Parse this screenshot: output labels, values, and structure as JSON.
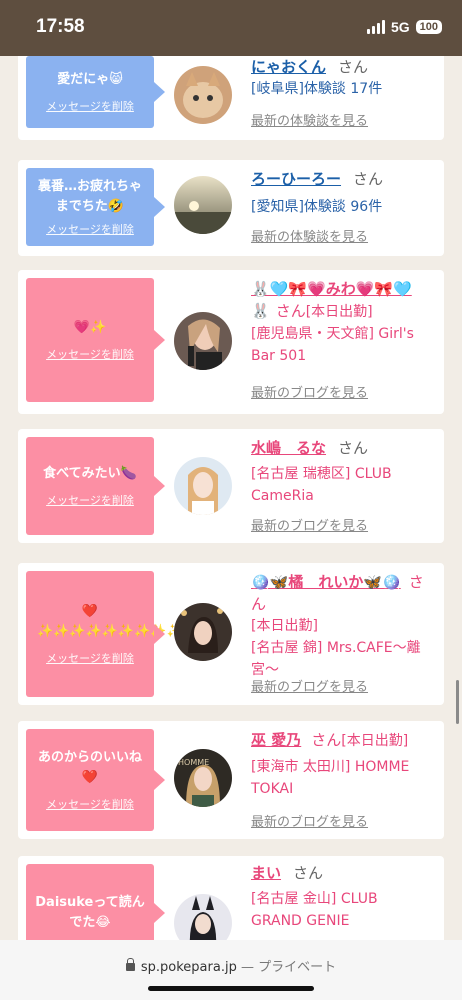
{
  "status": {
    "time": "17:58",
    "network": "5G",
    "battery": "100"
  },
  "cards": [
    {
      "bubble": {
        "text": "愛だにゃ😸",
        "delete": "メッセージを削除",
        "color": "#8bb2f0"
      },
      "name": "にゃおくん",
      "suffix": "さん",
      "badge": "",
      "lines": [
        "[岐阜県]体験談 17件"
      ],
      "link": "最新の体験談を見る",
      "avatar": "cat-photo"
    },
    {
      "bubble": {
        "text": "裏番…お疲れちゃまでちた🤣",
        "delete": "メッセージを削除",
        "color": "#8bb2f0"
      },
      "name": "ろーひーろー",
      "suffix": "さん",
      "badge": "",
      "lines": [
        "[愛知県]体験談 96件"
      ],
      "link": "最新の体験談を見る",
      "avatar": "sunset-photo"
    },
    {
      "bubble": {
        "text": "💗✨",
        "delete": "メッセージを削除",
        "color": "#fc8fa4"
      },
      "name": "🐰🩵🎀💗みわ💗🎀🩵",
      "name2": "🐰",
      "suffix": "さん",
      "badge": "[本日出勤]",
      "lines": [
        "[鹿児島県・天文館] Girl's",
        "Bar 501"
      ],
      "link": "最新のブログを見る",
      "avatar": "woman-photo"
    },
    {
      "bubble": {
        "text": "食べてみたい🍆",
        "delete": "メッセージを削除",
        "color": "#fc8fa4"
      },
      "name": "水嶋　るな",
      "suffix": "さん",
      "badge": "",
      "lines": [
        "[名古屋 瑞穂区] CLUB",
        "CameRia"
      ],
      "link": "最新のブログを見る",
      "avatar": "woman-photo"
    },
    {
      "bubble": {
        "text": "❤️✨✨✨✨✨✨✨✨✨✨",
        "delete": "メッセージを削除",
        "color": "#fc8fa4"
      },
      "name": "🪩🦋橘　れいか🦋🪩",
      "suffix": "さん",
      "badge": "[本日出勤]",
      "lines": [
        "[名古屋 錦] Mrs.CAFE〜離",
        "宮〜"
      ],
      "link": "最新のブログを見る",
      "avatar": "woman-photo"
    },
    {
      "bubble": {
        "text": "あのからのいいね❤️",
        "delete": "メッセージを削除",
        "color": "#fc8fa4"
      },
      "name": "巫 愛乃",
      "suffix": "さん",
      "badge": "[本日出勤]",
      "lines": [
        "[東海市 太田川] HOMME",
        "TOKAI"
      ],
      "link": "最新のブログを見る",
      "avatar": "woman-photo"
    },
    {
      "bubble": {
        "text": "Daisukeって読んでた😂",
        "delete": "メッセージを削除",
        "color": "#fc8fa4"
      },
      "name": "まい",
      "suffix": "さん",
      "badge": "",
      "lines": [
        "[名古屋 金山] CLUB",
        "GRAND GENIE"
      ],
      "link": "",
      "avatar": "woman-photo"
    }
  ],
  "browser": {
    "url": "sp.pokepara.jp",
    "sep": "—",
    "mode": "プライベート"
  }
}
